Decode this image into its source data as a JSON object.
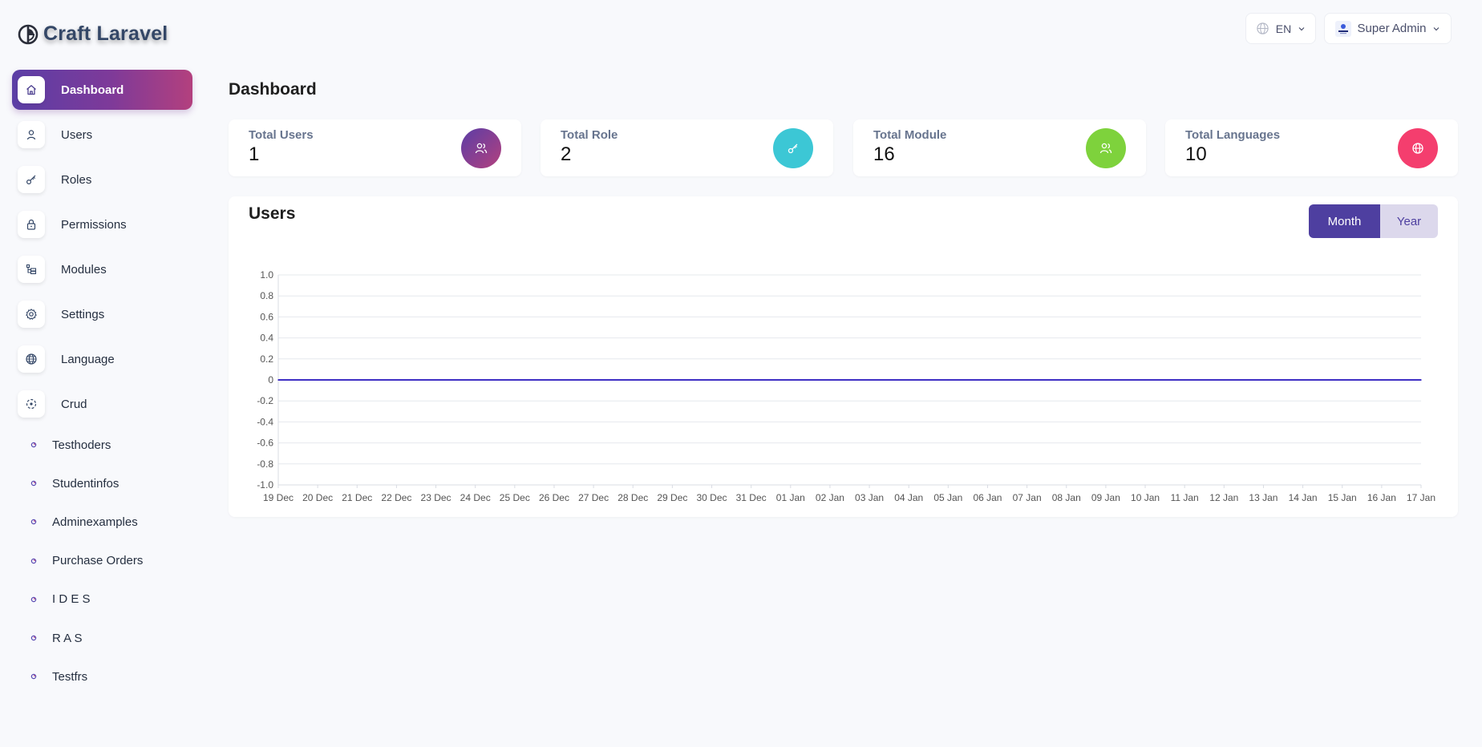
{
  "brand": {
    "name": "Craft Laravel"
  },
  "sidebar": {
    "items": [
      {
        "label": "Dashboard",
        "icon": "home-icon",
        "active": true
      },
      {
        "label": "Users",
        "icon": "user-icon"
      },
      {
        "label": "Roles",
        "icon": "key-icon"
      },
      {
        "label": "Permissions",
        "icon": "lock-icon"
      },
      {
        "label": "Modules",
        "icon": "modules-icon"
      },
      {
        "label": "Settings",
        "icon": "gear-icon"
      },
      {
        "label": "Language",
        "icon": "globe-icon"
      },
      {
        "label": "Crud",
        "icon": "crud-icon"
      }
    ],
    "crud_items": [
      {
        "label": "Testhoders"
      },
      {
        "label": "Studentinfos"
      },
      {
        "label": "Adminexamples"
      },
      {
        "label": "Purchase Orders"
      },
      {
        "label": "I D E S"
      },
      {
        "label": "R A S"
      },
      {
        "label": "Testfrs"
      }
    ]
  },
  "header": {
    "language": "EN",
    "user": "Super Admin"
  },
  "page": {
    "title": "Dashboard"
  },
  "stats": [
    {
      "label": "Total Users",
      "value": "1",
      "icon": "users-icon",
      "color": "#7b3b97"
    },
    {
      "label": "Total Role",
      "value": "2",
      "icon": "key-icon",
      "color": "#3cc7d5"
    },
    {
      "label": "Total Module",
      "value": "16",
      "icon": "users-icon",
      "color": "#7ed23c"
    },
    {
      "label": "Total Languages",
      "value": "10",
      "icon": "globe-icon",
      "color": "#f43e6e"
    }
  ],
  "chart_section": {
    "title": "Users",
    "toggle": {
      "month": "Month",
      "year": "Year",
      "selected": "month"
    }
  },
  "chart_data": {
    "type": "line",
    "x": [
      "19 Dec",
      "20 Dec",
      "21 Dec",
      "22 Dec",
      "23 Dec",
      "24 Dec",
      "25 Dec",
      "26 Dec",
      "27 Dec",
      "28 Dec",
      "29 Dec",
      "30 Dec",
      "31 Dec",
      "01 Jan",
      "02 Jan",
      "03 Jan",
      "04 Jan",
      "05 Jan",
      "06 Jan",
      "07 Jan",
      "08 Jan",
      "09 Jan",
      "10 Jan",
      "11 Jan",
      "12 Jan",
      "13 Jan",
      "14 Jan",
      "15 Jan",
      "16 Jan",
      "17 Jan"
    ],
    "series": [
      {
        "values": [
          0,
          0,
          0,
          0,
          0,
          0,
          0,
          0,
          0,
          0,
          0,
          0,
          0,
          0,
          0,
          0,
          0,
          0,
          0,
          0,
          0,
          0,
          0,
          0,
          0,
          0,
          0,
          0,
          0,
          0
        ],
        "color": "#3f2fc4"
      }
    ],
    "ylim": [
      -1.0,
      1.0
    ],
    "yticks": [
      "1.0",
      "0.8",
      "0.6",
      "0.4",
      "0.2",
      "0",
      "-0.2",
      "-0.4",
      "-0.6",
      "-0.8",
      "-1.0"
    ],
    "grid": true,
    "legend": "none"
  }
}
